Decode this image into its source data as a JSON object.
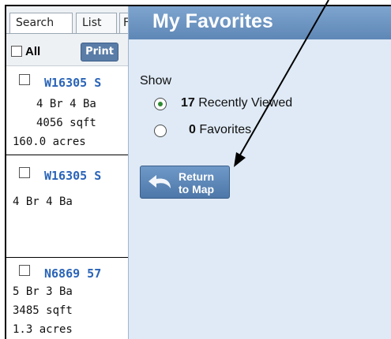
{
  "left_panel": {
    "tabs": {
      "search": "Search",
      "list": "List",
      "fav": "F"
    },
    "toolbar": {
      "all_label": "All",
      "print_label": "Print"
    },
    "listings": [
      {
        "title": "W16305 S",
        "details": [
          "4 Br 4 Ba",
          "4056 sqft",
          "160.0 acres"
        ]
      },
      {
        "title": "W16305 S",
        "details": [
          "4 Br 4 Ba"
        ]
      },
      {
        "title": "N6869 57",
        "details": [
          "5 Br 3 Ba",
          "3485 sqft",
          "1.3 acres"
        ]
      }
    ]
  },
  "favorites_panel": {
    "title": "My Favorites",
    "show_label": "Show",
    "options": [
      {
        "count": "17",
        "label": "Recently Viewed",
        "selected": true
      },
      {
        "count": "0",
        "label": "Favorites",
        "selected": false
      }
    ],
    "return_button": {
      "line1": "Return",
      "line2": "to Map",
      "icon": "return-arrow-icon"
    }
  },
  "colors": {
    "header": "#6a92c0",
    "panel_bg": "#dfeaf6",
    "link": "#2a64b8",
    "button": "#5a7da8",
    "radio_selected": "#2f8a2f"
  }
}
